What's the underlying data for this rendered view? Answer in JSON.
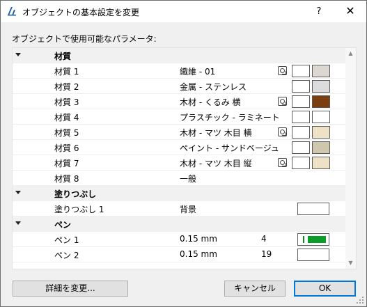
{
  "window": {
    "title": "オブジェクトの基本設定を変更",
    "help_label": "?",
    "close_label": "✕"
  },
  "section_label": "オブジェクトで使用可能なパラメータ:",
  "groups": {
    "materials": {
      "label": "材質",
      "items": [
        {
          "name": "材質 1",
          "value": "織維 - 01",
          "texture": true,
          "color": "#dcd8d1"
        },
        {
          "name": "材質 2",
          "value": "金属 - ステンレス",
          "texture": false,
          "color": "#dcdcdf"
        },
        {
          "name": "材質 3",
          "value": "木材 - くるみ 横",
          "texture": true,
          "color": "#7b3e12"
        },
        {
          "name": "材質 4",
          "value": "プラスチック - ラミネート",
          "texture": false,
          "color": "#ffffff"
        },
        {
          "name": "材質 5",
          "value": "木材 - マツ 木目 横",
          "texture": true,
          "color": "#efe1c6"
        },
        {
          "name": "材質 6",
          "value": "ペイント - サンドベージュ",
          "texture": false,
          "color": "#cfc7ad"
        },
        {
          "name": "材質 7",
          "value": "木材 - マツ 木目 縦",
          "texture": true,
          "color": "#efe1c6"
        },
        {
          "name": "材質 8",
          "value": "一般",
          "texture": false,
          "color": ""
        }
      ]
    },
    "fills": {
      "label": "塗りつぶし",
      "items": [
        {
          "name": "塗りつぶし 1",
          "value": "背景"
        }
      ]
    },
    "pens": {
      "label": "ペン",
      "items": [
        {
          "name": "ペン 1",
          "value": "0.15 mm",
          "number": "4",
          "color": "#0a9d2a"
        },
        {
          "name": "ペン 2",
          "value": "0.15 mm",
          "number": "19",
          "color": "#ffffff"
        }
      ]
    }
  },
  "buttons": {
    "details": "詳細を変更...",
    "cancel": "キャンセル",
    "ok": "OK"
  },
  "colors": {
    "accent": "#0078d7",
    "pen_green": "#0a9d2a"
  }
}
